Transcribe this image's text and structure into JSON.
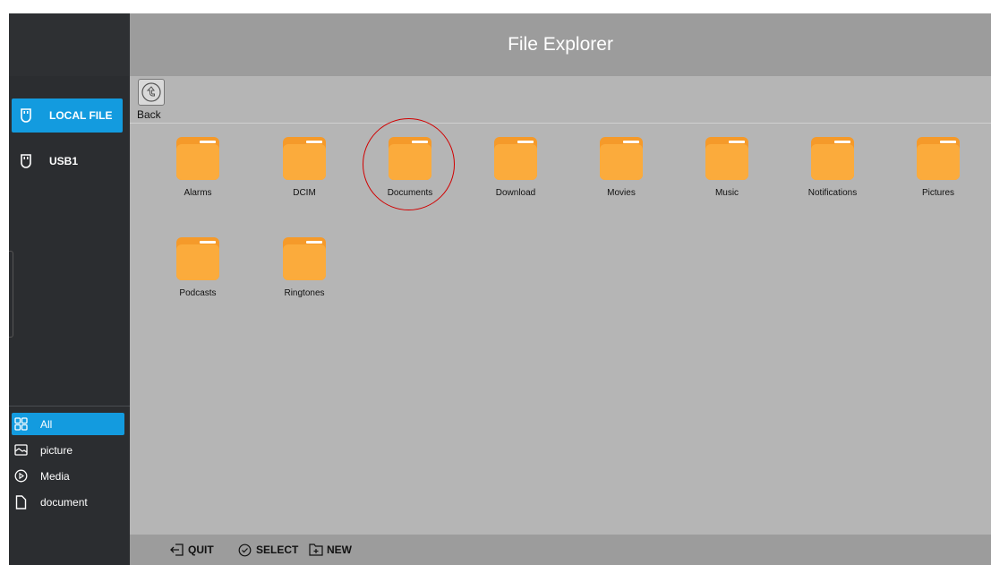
{
  "header": {
    "title": "File Explorer"
  },
  "toolbar": {
    "back_label": "Back"
  },
  "sidebar": {
    "devices": [
      {
        "label": "LOCAL FILE",
        "icon": "usb-drive-icon",
        "active": true
      },
      {
        "label": "USB1",
        "icon": "usb-drive-icon",
        "active": false
      }
    ],
    "categories": [
      {
        "label": "All",
        "icon": "grid-icon",
        "active": true
      },
      {
        "label": "picture",
        "icon": "image-icon",
        "active": false
      },
      {
        "label": "Media",
        "icon": "play-icon",
        "active": false
      },
      {
        "label": "document",
        "icon": "document-icon",
        "active": false
      }
    ]
  },
  "folders": [
    {
      "label": "Alarms"
    },
    {
      "label": "DCIM"
    },
    {
      "label": "Documents",
      "highlighted": true
    },
    {
      "label": "Download"
    },
    {
      "label": "Movies"
    },
    {
      "label": "Music"
    },
    {
      "label": "Notifications"
    },
    {
      "label": "Pictures"
    },
    {
      "label": "Podcasts"
    },
    {
      "label": "Ringtones"
    }
  ],
  "footer": {
    "quit_label": "QUIT",
    "select_label": "SELECT",
    "new_label": "NEW"
  },
  "colors": {
    "accent": "#139bdf",
    "sidebar_bg": "#2b2d30",
    "header_bg": "#9c9c9c",
    "content_bg": "#b5b5b5",
    "folder": "#fbab3c",
    "highlight_ring": "#d10000"
  }
}
